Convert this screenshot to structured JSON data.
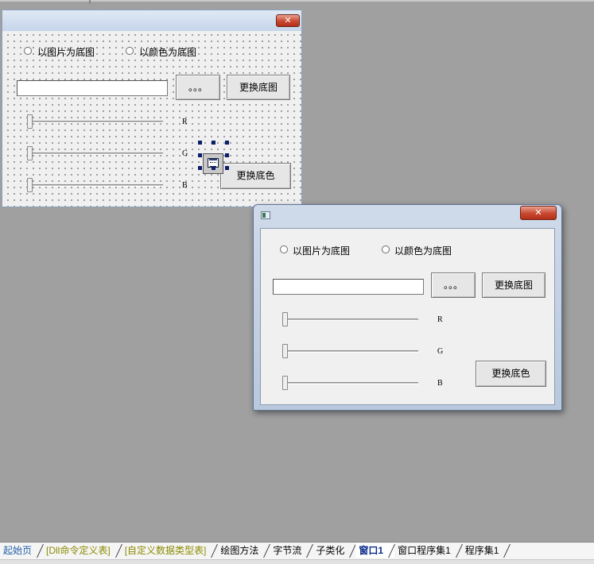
{
  "design_form": {
    "close_glyph": "✕",
    "radio_picture": "以图片为底图",
    "radio_color": "以颜色为底图",
    "browse_label": "。。。",
    "change_image_label": "更换底图",
    "change_color_label": "更换底色",
    "slider_r_label": "R",
    "slider_g_label": "G",
    "slider_b_label": "B",
    "textbox_value": ""
  },
  "runtime_window": {
    "close_glyph": "✕",
    "radio_picture": "以图片为底图",
    "radio_color": "以颜色为底图",
    "browse_label": "。。。",
    "change_image_label": "更换底图",
    "change_color_label": "更换底色",
    "slider_r_label": "R",
    "slider_g_label": "G",
    "slider_b_label": "B",
    "textbox_value": "",
    "sliders": {
      "r": 0,
      "g": 0,
      "b": 0
    }
  },
  "tabs": [
    {
      "label": "起始页",
      "color": "#1f5fa8"
    },
    {
      "label": "[Dll命令定义表]",
      "color": "#8a8a00"
    },
    {
      "label": "[自定义数据类型表]",
      "color": "#8a8a00"
    },
    {
      "label": "绘图方法",
      "color": "#000000"
    },
    {
      "label": "字节流",
      "color": "#000000"
    },
    {
      "label": "子类化",
      "color": "#000000"
    },
    {
      "label": "窗口1",
      "color": "#0a2a8a",
      "active": true
    },
    {
      "label": "窗口程序集1",
      "color": "#000000"
    },
    {
      "label": "程序集1",
      "color": "#000000"
    }
  ]
}
